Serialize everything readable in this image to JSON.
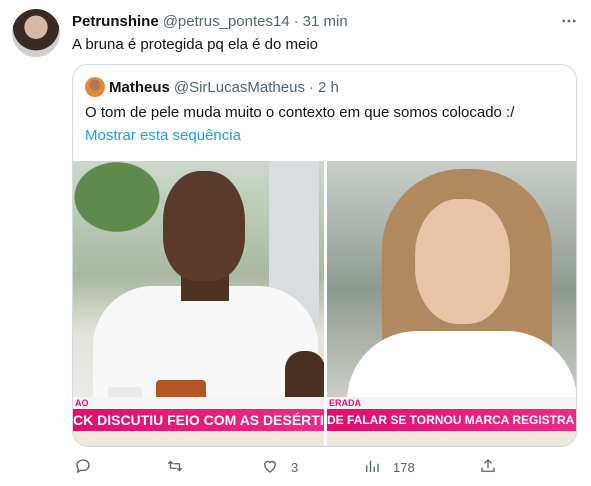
{
  "tweet": {
    "display_name": "Petrunshine",
    "handle": "@petrus_pontes14",
    "separator": "·",
    "time": "31 min",
    "more_icon": "more-horizontal-icon",
    "text": "A bruna é protegida pq ela é do meio"
  },
  "quoted": {
    "display_name": "Matheus",
    "handle": "@SirLucasMatheus",
    "separator": "·",
    "time": "2 h",
    "text": "O tom de pele muda muito o contexto em que somos colocado :/",
    "show_thread_link": "Mostrar esta sequência",
    "media": {
      "left_ticker_top": "AO",
      "left_ticker_text": "CK DISCUTIU FEIO COM AS DESÉRTICA",
      "right_ticker_top": "ERADA",
      "right_ticker_text": "DE FALAR SE TORNOU MARCA REGISTRA DA BRUNA"
    }
  },
  "actions": {
    "reply": {
      "icon": "reply-icon",
      "count": ""
    },
    "retweet": {
      "icon": "retweet-icon",
      "count": ""
    },
    "like": {
      "icon": "heart-icon",
      "count": "3"
    },
    "views": {
      "icon": "views-chart-icon",
      "count": "178"
    },
    "share": {
      "icon": "share-icon",
      "count": ""
    }
  },
  "colors": {
    "link_blue": "#1d9bf0",
    "secondary_text": "#536471",
    "border": "#cfd9de",
    "ticker_pink": "#e10e6f"
  }
}
